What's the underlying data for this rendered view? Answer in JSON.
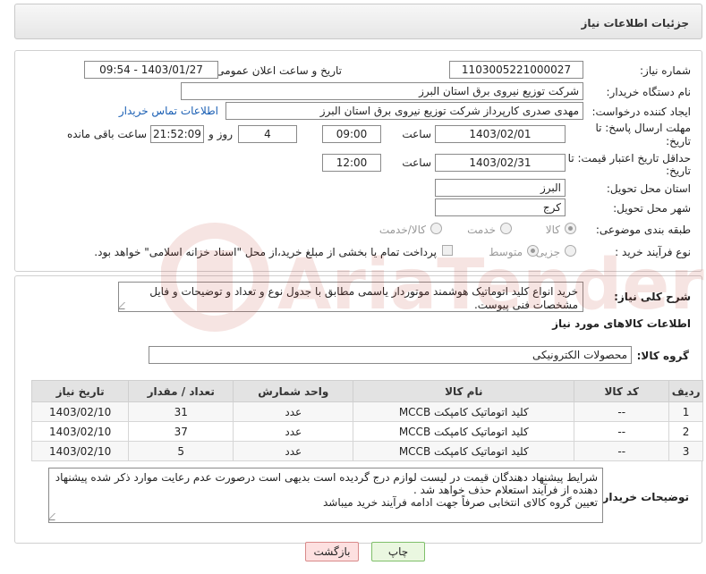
{
  "header": {
    "title": "جزئیات اطلاعات نیاز"
  },
  "details": {
    "need_number_label": "شماره نیاز:",
    "need_number": "1103005221000027",
    "announce_label": "تاریخ و ساعت اعلان عمومی:",
    "announce_value": "1403/01/27 - 09:54",
    "buyer_org_label": "نام دستگاه خریدار:",
    "buyer_org": "شرکت توزیع نیروی برق استان البرز",
    "creator_label": "ایجاد کننده درخواست:",
    "creator": "مهدی صدری کارپرداز شرکت توزیع نیروی برق استان البرز",
    "contact_link": "اطلاعات تماس خریدار",
    "deadline_label_1": "مهلت ارسال پاسخ: تا",
    "deadline_label_2": "تاریخ:",
    "deadline_date": "1403/02/01",
    "time_label": "ساعت",
    "deadline_time": "09:00",
    "days_value": "4",
    "days_label": "روز و",
    "remaining_time": "21:52:09",
    "remaining_label": "ساعت باقی مانده",
    "validity_label_1": "حداقل تاریخ اعتبار قیمت: تا",
    "validity_label_2": "تاریخ:",
    "validity_date": "1403/02/31",
    "validity_time": "12:00",
    "province_label": "استان محل تحویل:",
    "province": "البرز",
    "city_label": "شهر محل تحویل:",
    "city": "کرج",
    "category_label": "طبقه بندی موضوعی:",
    "category_options": [
      "کالا",
      "خدمت",
      "کالا/خدمت"
    ],
    "process_label": "نوع فرآیند خرید :",
    "process_options": [
      "جزیی",
      "متوسط"
    ],
    "payment_note": "پرداخت تمام یا بخشی از مبلغ خرید،از محل \"اسناد خزانه اسلامی\" خواهد بود."
  },
  "description": {
    "label": "شرح کلی نیاز:",
    "text": "خرید انواع کلید اتوماتیک هوشمند موتوردار یاسمی مطابق با جدول نوع و تعداد و توضیحات و فایل مشخصات فنی پیوست."
  },
  "goods": {
    "section_title": "اطلاعات کالاهای مورد نیاز",
    "group_label": "گروه کالا:",
    "group_value": "محصولات الکترونیکی",
    "columns": [
      "ردیف",
      "کد کالا",
      "نام کالا",
      "واحد شمارش",
      "تعداد / مقدار",
      "تاریخ نیاز"
    ],
    "rows": [
      {
        "row": "1",
        "code": "--",
        "name": "کلید اتوماتیک کامپکت MCCB",
        "unit": "عدد",
        "qty": "31",
        "date": "1403/02/10"
      },
      {
        "row": "2",
        "code": "--",
        "name": "کلید اتوماتیک کامپکت MCCB",
        "unit": "عدد",
        "qty": "37",
        "date": "1403/02/10"
      },
      {
        "row": "3",
        "code": "--",
        "name": "کلید اتوماتیک کامپکت MCCB",
        "unit": "عدد",
        "qty": "5",
        "date": "1403/02/10"
      }
    ]
  },
  "buyer_notes": {
    "label": "توضیحات خریدار:",
    "line1": "شرایط پیشنهاد دهندگان قیمت در لیست لوازم درج گردیده است بدیهی است درصورت عدم رعایت موارد  ذکر شده پیشنهاد",
    "line2": "دهنده از فرآیند استعلام حذف خواهد شد .",
    "line3": "تعیین گروه کالای انتخابی صرفاً جهت ادامه فرآیند خرید میباشد"
  },
  "buttons": {
    "print": "چاپ",
    "back": "بازگشت"
  }
}
